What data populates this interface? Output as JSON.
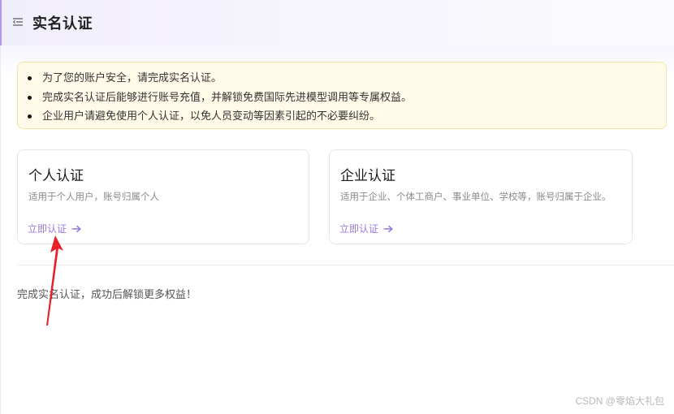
{
  "header": {
    "title": "实名认证",
    "menu_icon": "menu-collapse-icon"
  },
  "notice": {
    "items": [
      "为了您的账户安全，请完成实名认证。",
      "完成实名认证后能够进行账号充值，并解锁免费国际先进模型调用等专属权益。",
      "企业用户请避免使用个人认证，以免人员变动等因素引起的不必要纠纷。"
    ]
  },
  "cards": [
    {
      "title": "个人认证",
      "description": "适用于个人用户，账号归属个人",
      "link_label": "立即认证",
      "link_icon": "arrow-right-icon"
    },
    {
      "title": "企业认证",
      "description": "适用于企业、个体工商户、事业单位、学校等，账号归属于企业。",
      "link_label": "立即认证",
      "link_icon": "arrow-right-icon"
    }
  ],
  "footer": {
    "text": "完成实名认证，成功后解锁更多权益！"
  },
  "annotation": {
    "arrow_color": "#e8202a"
  },
  "watermark": "CSDN @零焰大礼包",
  "colors": {
    "accent": "#9b7be0",
    "notice_bg": "#fffbe8",
    "notice_border": "#f4e4a7"
  }
}
